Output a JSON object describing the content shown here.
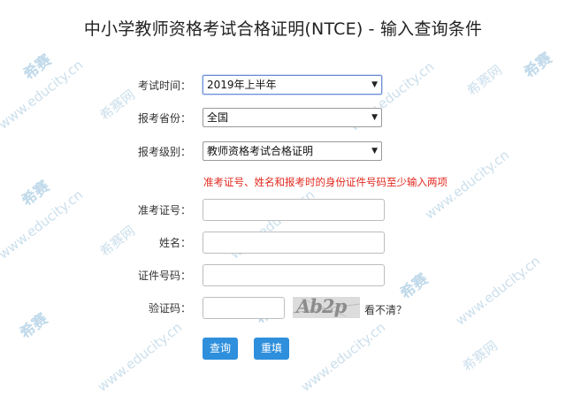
{
  "page": {
    "title": "中小学教师资格考试合格证明(NTCE) - 输入查询条件"
  },
  "form": {
    "exam_time": {
      "label": "考试时间：",
      "value": "2019年上半年"
    },
    "province": {
      "label": "报考省份：",
      "value": "全国"
    },
    "level": {
      "label": "报考级别：",
      "value": "教师资格考试合格证明"
    },
    "hint": "准考证号、姓名和报考时的身份证件号码至少输入两项",
    "admission_no": {
      "label": "准考证号：",
      "value": ""
    },
    "name": {
      "label": "姓名：",
      "value": ""
    },
    "id_no": {
      "label": "证件号码：",
      "value": ""
    },
    "captcha": {
      "label": "验证码：",
      "value": "",
      "image_text": "Ab2p",
      "refresh_label": "看不清？"
    }
  },
  "buttons": {
    "query": "查询",
    "reset": "重填"
  },
  "watermark": {
    "logo": "希赛",
    "site": "www.educity.cn",
    "brand": "希赛网"
  },
  "colors": {
    "button": "#2e8fdc",
    "hint": "#e0271d",
    "watermark": "#c6dcea"
  }
}
